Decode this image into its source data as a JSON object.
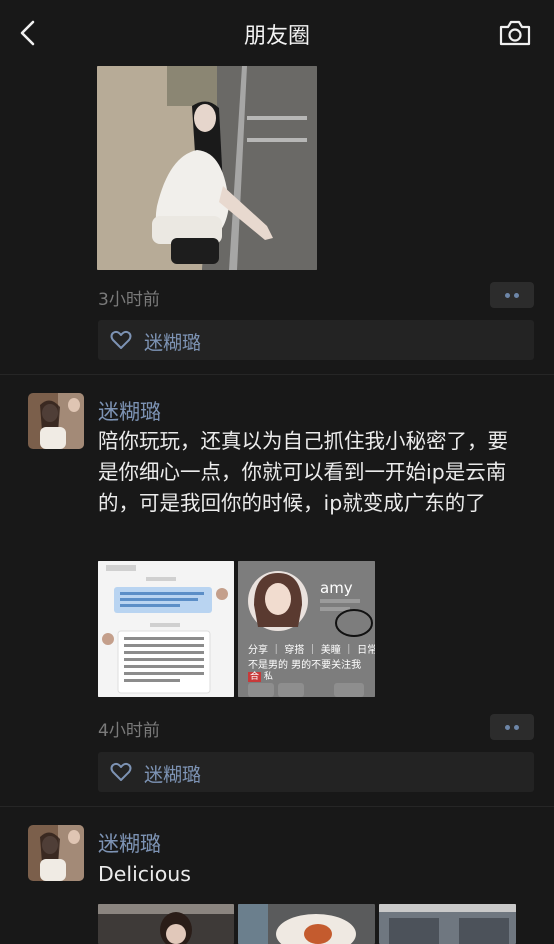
{
  "header": {
    "title": "朋友圈",
    "back_icon": "chevron-left-icon",
    "camera_icon": "camera-icon"
  },
  "posts": [
    {
      "timestamp": "3小时前",
      "likes": [
        "迷糊璐"
      ]
    },
    {
      "username": "迷糊璐",
      "text": "陪你玩玩，还真以为自己抓住我小秘密了，要是你细心一点，你就可以看到一开始ip是云南的，可是我回你的时候，ip就变成广东的了",
      "timestamp": "4小时前",
      "likes": [
        "迷糊璐"
      ],
      "image2": {
        "name": "amy",
        "tags": "分享 ｜ 穿搭 ｜ 美瞳 ｜ 日常",
        "line2": "不是男的 男的不要关注我",
        "badge": "合",
        "badge_text": "私"
      }
    },
    {
      "username": "迷糊璐",
      "text": "Delicious"
    }
  ],
  "colors": {
    "background": "#181818",
    "link": "#7d93b4",
    "meta": "#7a7a7a"
  }
}
